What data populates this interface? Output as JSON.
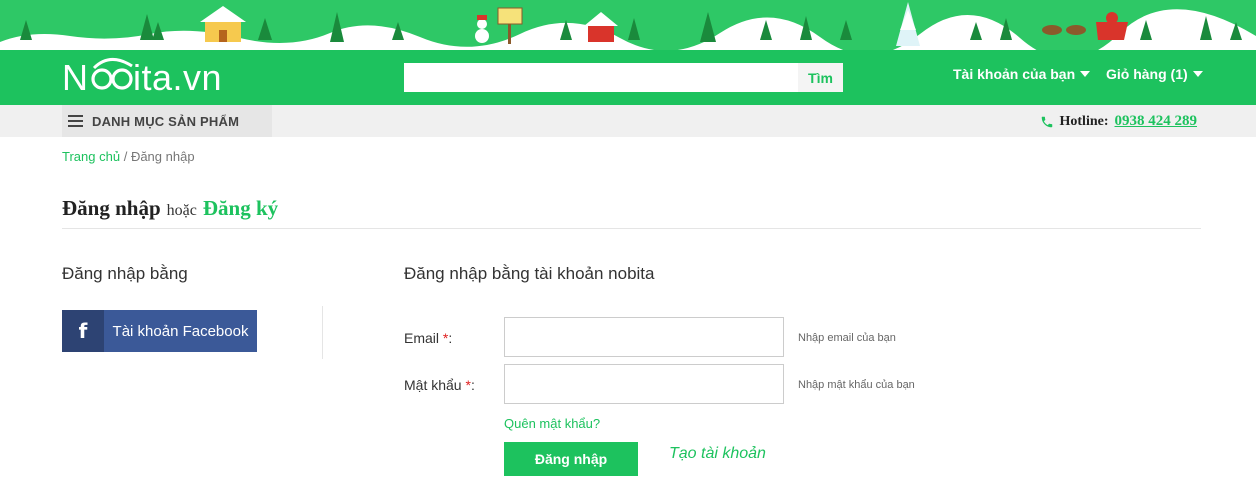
{
  "banner": {
    "sign_text": "",
    "theme": "christmas"
  },
  "header": {
    "logo_text": "Nobita.vn",
    "logo_prefix": "N",
    "logo_suffix": "ita.vn",
    "search": {
      "value": "",
      "placeholder": "",
      "button_label": "Tìm"
    },
    "account_label": "Tài khoản của bạn",
    "cart_label": "Giỏ hàng (1)",
    "brand_color": "#1dc25e"
  },
  "subnav": {
    "catalog_label": "DANH MỤC SẢN PHẨM",
    "hotline_label": "Hotline:",
    "hotline_number": "0938 424 289"
  },
  "breadcrumb": {
    "home": "Trang chủ",
    "sep": "/",
    "current": "Đăng nhập"
  },
  "page_title": {
    "login": "Đăng nhập",
    "or": "hoặc",
    "register": "Đăng ký"
  },
  "social": {
    "heading": "Đăng nhập bằng",
    "facebook_label": "Tài khoản Facebook",
    "facebook_icon": "facebook-icon",
    "facebook_color": "#3b5998"
  },
  "form": {
    "heading": "Đăng nhập bằng tài khoản nobita",
    "email": {
      "label": "Email",
      "required": "*",
      "suffix": ":",
      "value": "",
      "hint": "Nhập email của bạn"
    },
    "password": {
      "label": "Mật khẩu",
      "required": "*",
      "suffix": ":",
      "value": "",
      "hint": "Nhập mật khẩu của bạn"
    },
    "forgot_label": "Quên mật khẩu?",
    "submit_label": "Đăng nhập",
    "create_label": "Tạo tài khoản"
  }
}
